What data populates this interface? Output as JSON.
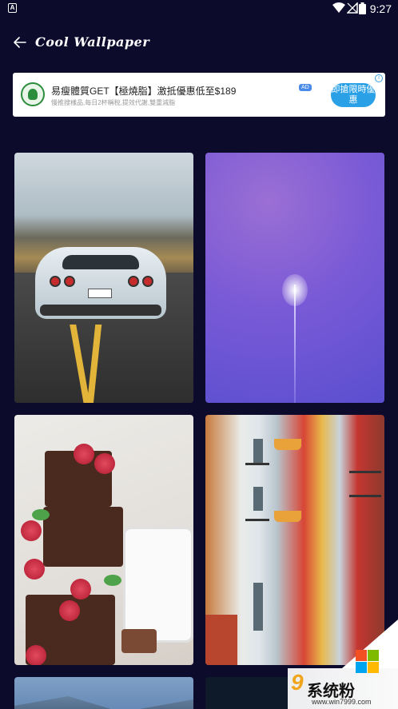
{
  "status_bar": {
    "left_icon": "A",
    "time": "9:27",
    "icons": [
      "wifi-icon",
      "signal-off-icon",
      "battery-icon"
    ]
  },
  "header": {
    "title": "Cool Wallpaper",
    "back_icon": "arrow-left-icon"
  },
  "ad": {
    "title": "易瘦體質GET【極燒脂】激抵優惠低至$189",
    "subtitle": "慢推搜樣品,每日2杯稱稅,提效代謝,雙重減脂",
    "badge": "AD",
    "cta": "即搶限時優惠",
    "info": "i"
  },
  "wallpapers": [
    {
      "name": "car-on-road"
    },
    {
      "name": "purple-flower"
    },
    {
      "name": "brownies-and-milk"
    },
    {
      "name": "colorful-street"
    },
    {
      "name": "mountain-sky"
    },
    {
      "name": "night-sky"
    }
  ],
  "watermark": {
    "text": "系统粉",
    "url": "www.win7999.com"
  },
  "colors": {
    "background": "#0d0b2c",
    "accent": "#2aa0e6"
  }
}
